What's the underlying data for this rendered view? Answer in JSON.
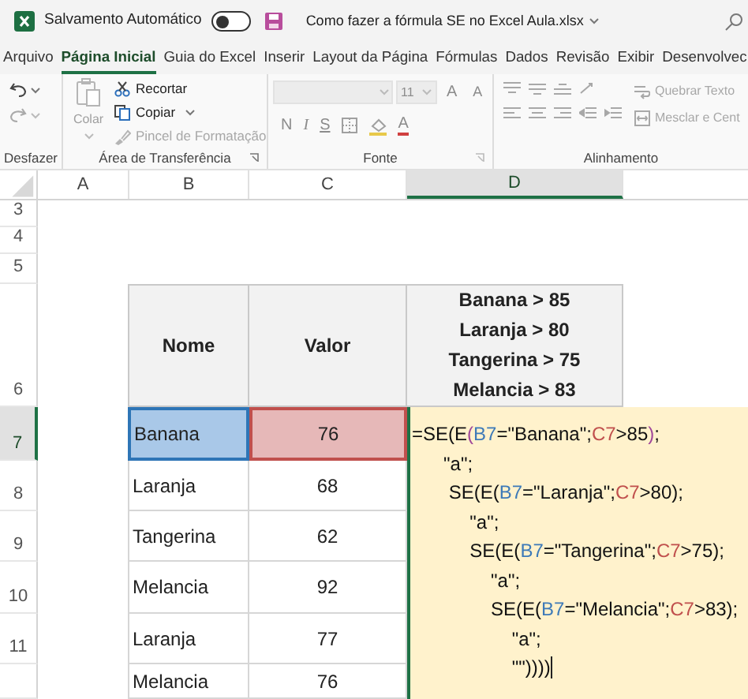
{
  "title_bar": {
    "autosave_label": "Salvamento Automático",
    "autosave_on": false,
    "file_name": "Como fazer a fórmula SE no Excel Aula.xlsx"
  },
  "menu_tabs": [
    {
      "label": "Arquivo",
      "selected": false
    },
    {
      "label": "Página Inicial",
      "selected": true
    },
    {
      "label": "Guia do Excel",
      "selected": false
    },
    {
      "label": "Inserir",
      "selected": false
    },
    {
      "label": "Layout da Página",
      "selected": false
    },
    {
      "label": "Fórmulas",
      "selected": false
    },
    {
      "label": "Dados",
      "selected": false
    },
    {
      "label": "Revisão",
      "selected": false
    },
    {
      "label": "Exibir",
      "selected": false
    },
    {
      "label": "Desenvolvec",
      "selected": false
    }
  ],
  "ribbon": {
    "undo_group": {
      "label": "Desfazer"
    },
    "clipboard": {
      "label": "Área de Transferência",
      "paste": {
        "label": "Colar",
        "disabled": true
      },
      "items": [
        {
          "label": "Recortar",
          "disabled": false
        },
        {
          "label": "Copiar",
          "disabled": false
        },
        {
          "label": "Pincel de Formatação",
          "disabled": true
        }
      ]
    },
    "font": {
      "label": "Fonte",
      "disabled": true,
      "size": "11",
      "increase": "A",
      "decrease": "A",
      "bold": "N",
      "italic": "I",
      "underline": "S",
      "color_letter": "A"
    },
    "alignment": {
      "label": "Alinhamento",
      "disabled": true,
      "wrap": "Quebrar Texto",
      "merge": "Mesclar e Cent"
    }
  },
  "sheet": {
    "columns": [
      {
        "label": "A",
        "selected": false
      },
      {
        "label": "B",
        "selected": false
      },
      {
        "label": "C",
        "selected": false
      },
      {
        "label": "D",
        "selected": true
      }
    ],
    "rows": [
      {
        "number": "3",
        "selected": false
      },
      {
        "number": "4",
        "selected": false
      },
      {
        "number": "5",
        "selected": false
      },
      {
        "number": "6",
        "selected": false
      },
      {
        "number": "7",
        "selected": true
      },
      {
        "number": "8",
        "selected": false
      },
      {
        "number": "9",
        "selected": false
      },
      {
        "number": "10",
        "selected": false
      },
      {
        "number": "11",
        "selected": false
      },
      {
        "selected": false
      }
    ],
    "table_headers": [
      {
        "lines": [
          "Nome"
        ]
      },
      {
        "lines": [
          "Valor"
        ]
      },
      {
        "lines": [
          "Banana > 85",
          "Laranja > 80",
          "Tangerina > 75",
          "Melancia > 83"
        ]
      }
    ],
    "table_rows": [
      {
        "name": "Banana",
        "value": "76",
        "name_referenced": true,
        "value_referenced": true
      },
      {
        "name": "Laranja",
        "value": "68"
      },
      {
        "name": "Tangerina",
        "value": "62"
      },
      {
        "name": "Melancia",
        "value": "92"
      },
      {
        "name": "Laranja",
        "value": "77"
      },
      {
        "name": "Melancia",
        "value": "76"
      }
    ],
    "formula_lines": [
      [
        {
          "text": "=SE(E",
          "kind": "plain"
        },
        {
          "text": "(",
          "kind": "paren"
        },
        {
          "text": "B7",
          "kind": "ref1"
        },
        {
          "text": "=\"Banana\";",
          "kind": "plain"
        },
        {
          "text": "C7",
          "kind": "ref2"
        },
        {
          "text": ">85",
          "kind": "plain"
        },
        {
          "text": ")",
          "kind": "paren"
        },
        {
          "text": ";",
          "kind": "plain"
        }
      ],
      [
        {
          "text": "      \"a\";",
          "kind": "plain"
        }
      ],
      [
        {
          "text": "       SE(E(",
          "kind": "plain"
        },
        {
          "text": "B7",
          "kind": "ref1"
        },
        {
          "text": "=\"Laranja\";",
          "kind": "plain"
        },
        {
          "text": "C7",
          "kind": "ref2"
        },
        {
          "text": ">80);",
          "kind": "plain"
        }
      ],
      [
        {
          "text": "           \"a\";",
          "kind": "plain"
        }
      ],
      [
        {
          "text": "           SE(E(",
          "kind": "plain"
        },
        {
          "text": "B7",
          "kind": "ref1"
        },
        {
          "text": "=\"Tangerina\";",
          "kind": "plain"
        },
        {
          "text": "C7",
          "kind": "ref2"
        },
        {
          "text": ">75);",
          "kind": "plain"
        }
      ],
      [
        {
          "text": "               \"a\";",
          "kind": "plain"
        }
      ],
      [
        {
          "text": "               SE(E(",
          "kind": "plain"
        },
        {
          "text": "B7",
          "kind": "ref1"
        },
        {
          "text": "=\"Melancia\";",
          "kind": "plain"
        },
        {
          "text": "C7",
          "kind": "ref2"
        },
        {
          "text": ">83);",
          "kind": "plain"
        }
      ],
      [
        {
          "text": "                   \"a\";",
          "kind": "plain"
        }
      ],
      [
        {
          "text": "                   \"\"))))",
          "kind": "plain"
        }
      ]
    ]
  }
}
